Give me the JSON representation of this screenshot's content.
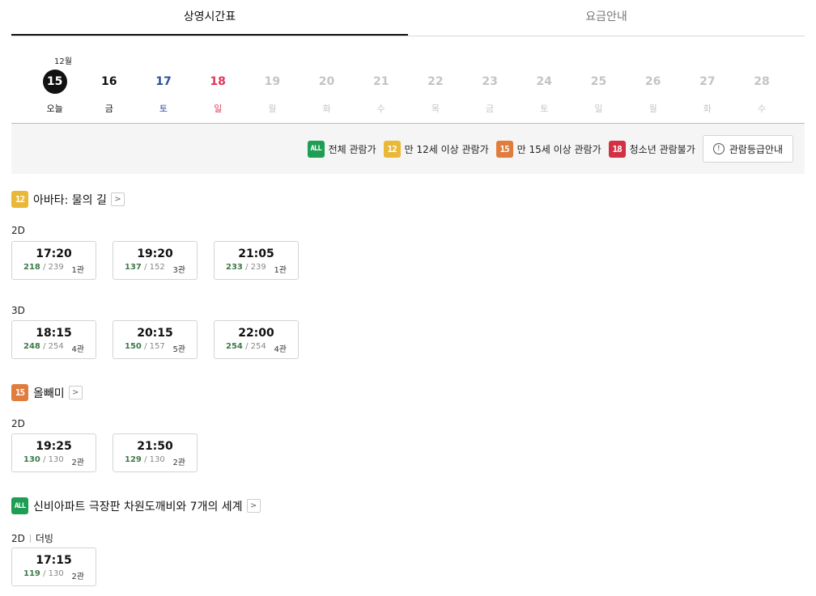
{
  "tabs": [
    {
      "label": "상영시간표",
      "active": true
    },
    {
      "label": "요금안내",
      "active": false
    }
  ],
  "dates": {
    "month": "12월",
    "items": [
      {
        "num": "15",
        "day": "오늘",
        "color": "today"
      },
      {
        "num": "16",
        "day": "금",
        "color": "black"
      },
      {
        "num": "17",
        "day": "토",
        "color": "blue"
      },
      {
        "num": "18",
        "day": "일",
        "color": "red"
      },
      {
        "num": "19",
        "day": "월",
        "color": "gray"
      },
      {
        "num": "20",
        "day": "화",
        "color": "gray"
      },
      {
        "num": "21",
        "day": "수",
        "color": "gray"
      },
      {
        "num": "22",
        "day": "목",
        "color": "gray"
      },
      {
        "num": "23",
        "day": "금",
        "color": "gray"
      },
      {
        "num": "24",
        "day": "토",
        "color": "gray"
      },
      {
        "num": "25",
        "day": "일",
        "color": "gray"
      },
      {
        "num": "26",
        "day": "월",
        "color": "gray"
      },
      {
        "num": "27",
        "day": "화",
        "color": "gray"
      },
      {
        "num": "28",
        "day": "수",
        "color": "gray"
      }
    ]
  },
  "ratings": {
    "legend": [
      {
        "badge": "ALL",
        "label": "전체 관람가",
        "color": "#1e9e54"
      },
      {
        "badge": "12",
        "label": "만 12세 이상 관람가",
        "color": "#e9b836"
      },
      {
        "badge": "15",
        "label": "만 15세 이상 관람가",
        "color": "#e07c3c"
      },
      {
        "badge": "18",
        "label": "청소년 관람불가",
        "color": "#d33044"
      }
    ],
    "guide_button": "관람등급안내",
    "guide_icon": "!"
  },
  "movies": [
    {
      "title": "아바타: 물의 길",
      "rating": "12",
      "groups": [
        {
          "format": "2D",
          "sub": "",
          "times": [
            {
              "time": "17:20",
              "avail": "218",
              "total": "/ 239",
              "hall": "1관"
            },
            {
              "time": "19:20",
              "avail": "137",
              "total": "/ 152",
              "hall": "3관"
            },
            {
              "time": "21:05",
              "avail": "233",
              "total": "/ 239",
              "hall": "1관"
            }
          ]
        },
        {
          "format": "3D",
          "sub": "",
          "times": [
            {
              "time": "18:15",
              "avail": "248",
              "total": "/ 254",
              "hall": "4관"
            },
            {
              "time": "20:15",
              "avail": "150",
              "total": "/ 157",
              "hall": "5관"
            },
            {
              "time": "22:00",
              "avail": "254",
              "total": "/ 254",
              "hall": "4관"
            }
          ]
        }
      ]
    },
    {
      "title": "올빼미",
      "rating": "15",
      "groups": [
        {
          "format": "2D",
          "sub": "",
          "times": [
            {
              "time": "19:25",
              "avail": "130",
              "total": "/ 130",
              "hall": "2관"
            },
            {
              "time": "21:50",
              "avail": "129",
              "total": "/ 130",
              "hall": "2관"
            }
          ]
        }
      ]
    },
    {
      "title": "신비아파트 극장판 차원도깨비와 7개의 세계",
      "rating": "ALL",
      "groups": [
        {
          "format": "2D",
          "sub": "더빙",
          "times": [
            {
              "time": "17:15",
              "avail": "119",
              "total": "/ 130",
              "hall": "2관"
            }
          ]
        }
      ]
    }
  ]
}
